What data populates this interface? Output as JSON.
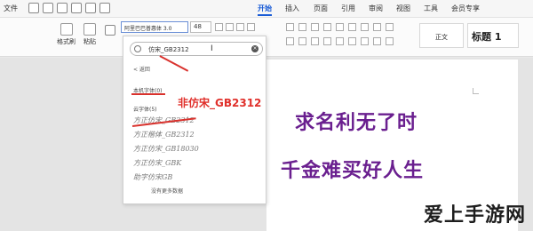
{
  "title_bar": {
    "file_menu": "文件"
  },
  "tabs": [
    "开始",
    "插入",
    "页面",
    "引用",
    "审阅",
    "视图",
    "工具",
    "会员专享"
  ],
  "ribbon": {
    "format_painter_label": "格式刷",
    "paste_label": "粘贴",
    "font_name": "阿里巴巴普惠体 3.0",
    "font_size": "48",
    "styles": [
      "正文",
      "标题 1"
    ]
  },
  "font_panel": {
    "search_value": "仿宋_GB2312",
    "back_label": "< 返回",
    "local_section": "本机字体(0)",
    "cloud_section": "云字体(5)",
    "fonts": [
      "方正仿宋_GB2312",
      "方正楷体_GB2312",
      "方正仿宋_GB18030",
      "方正仿宋_GBK",
      "助字仿宋GB"
    ],
    "no_more": "没有更多数据"
  },
  "annotation": "非仿宋_GB2312",
  "document": {
    "line1": "求名利无了时",
    "line2": "千金难买好人生"
  },
  "watermark": "爱上手游网",
  "colors": {
    "accent": "#1a5cd6",
    "annotation_red": "#e0302b",
    "doc_text": "#6a1f8f"
  }
}
